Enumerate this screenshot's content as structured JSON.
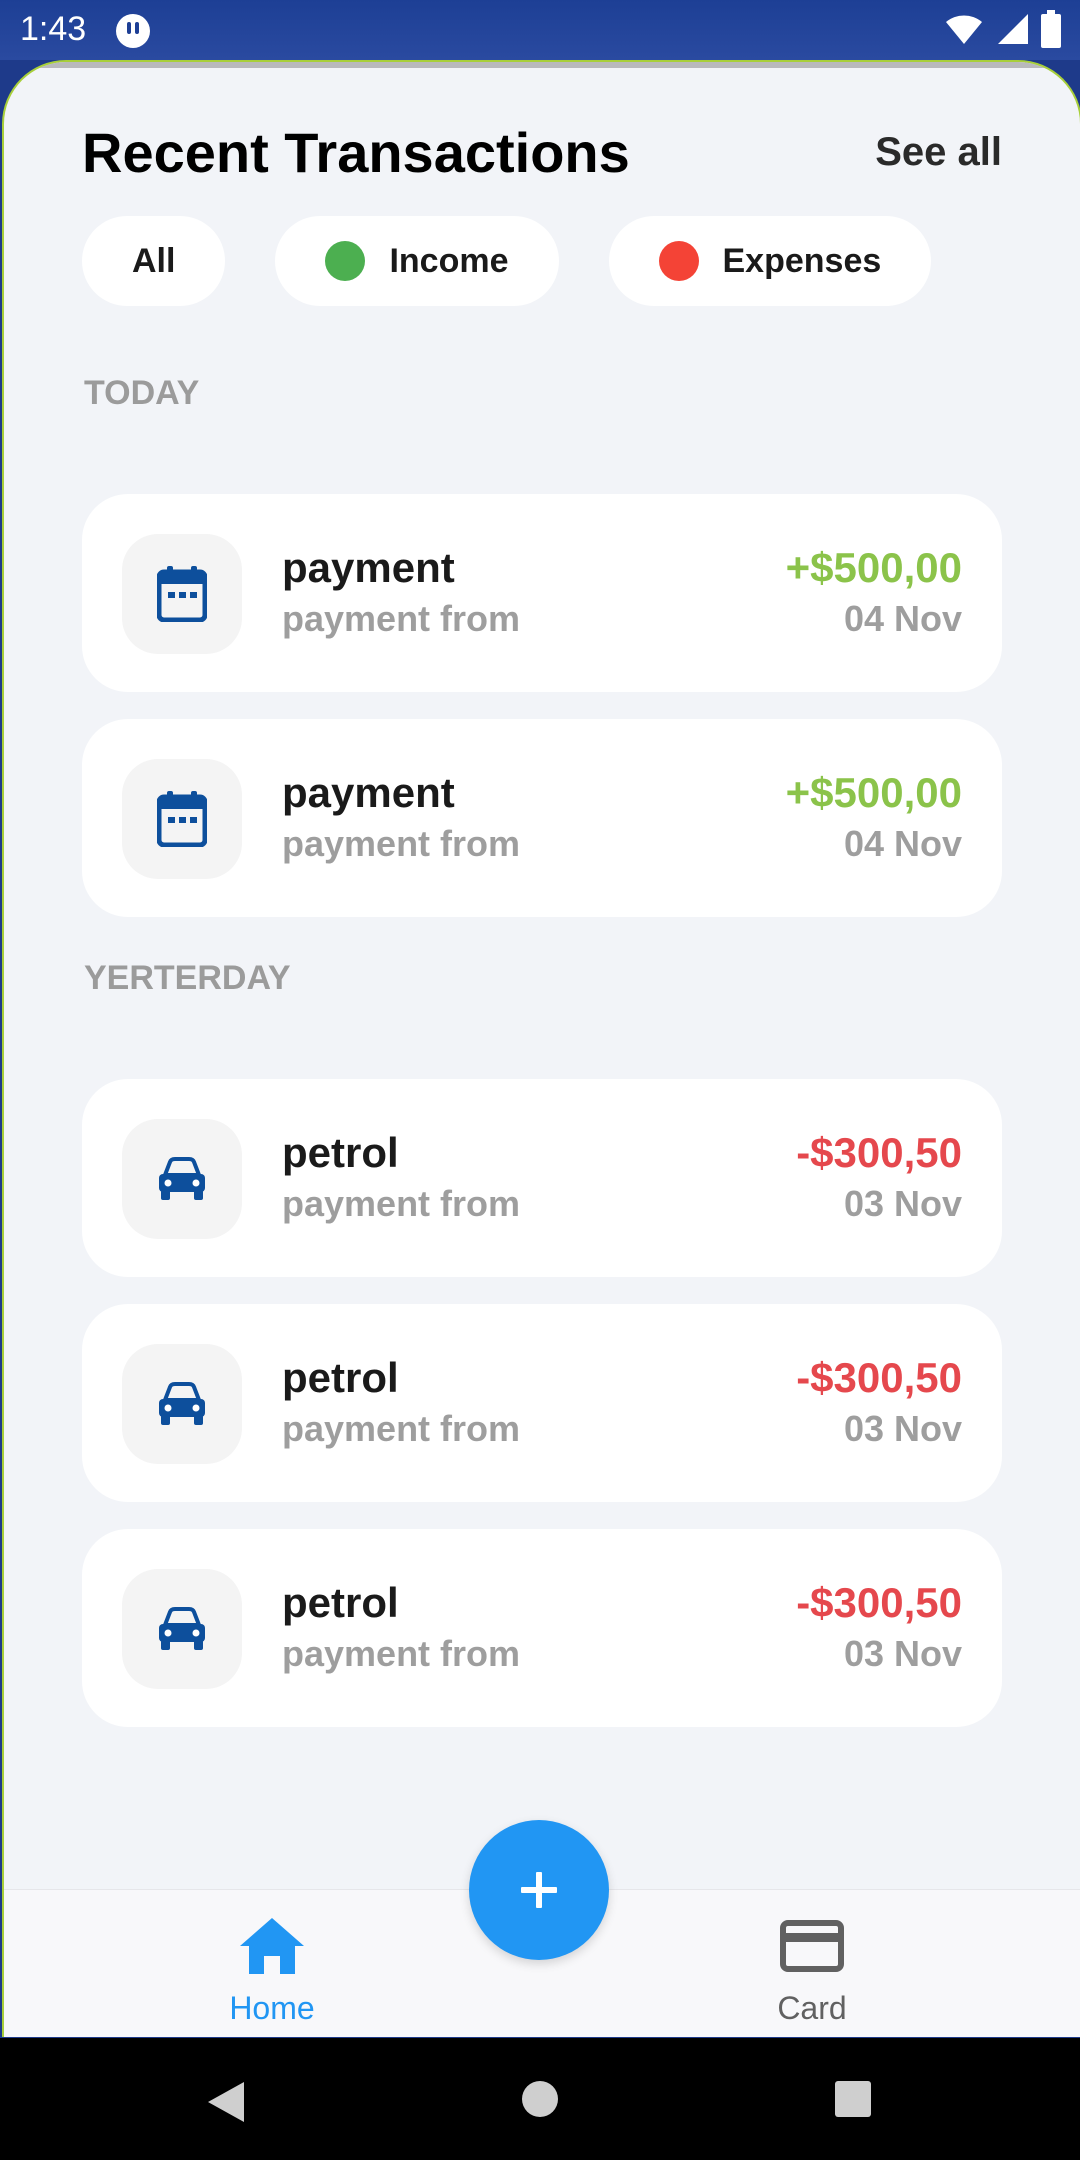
{
  "status_bar": {
    "time": "1:43",
    "icons": [
      "app-notification-icon",
      "wifi-icon",
      "signal-icon",
      "battery-icon"
    ]
  },
  "header": {
    "title": "Recent Transactions",
    "see_all_label": "See all"
  },
  "filters": [
    {
      "label": "All"
    },
    {
      "label": "Income",
      "dot_color": "#4caf50"
    },
    {
      "label": "Expenses",
      "dot_color": "#f44336"
    }
  ],
  "sections": [
    {
      "label": "TODAY",
      "items": [
        {
          "icon": "calendar-icon",
          "title": "payment",
          "subtitle": "payment from",
          "amount": "+$500,00",
          "date": "04 Nov",
          "type": "income"
        },
        {
          "icon": "calendar-icon",
          "title": "payment",
          "subtitle": "payment from",
          "amount": "+$500,00",
          "date": "04 Nov",
          "type": "income"
        }
      ]
    },
    {
      "label": "YERTERDAY",
      "items": [
        {
          "icon": "car-icon",
          "title": "petrol",
          "subtitle": "payment from",
          "amount": "-$300,50",
          "date": "03 Nov",
          "type": "expense"
        },
        {
          "icon": "car-icon",
          "title": "petrol",
          "subtitle": "payment from",
          "amount": "-$300,50",
          "date": "03 Nov",
          "type": "expense"
        },
        {
          "icon": "car-icon",
          "title": "petrol",
          "subtitle": "payment from",
          "amount": "-$300,50",
          "date": "03 Nov",
          "type": "expense"
        }
      ]
    }
  ],
  "bottom_nav": {
    "home_label": "Home",
    "card_label": "Card",
    "fab_icon": "plus-icon"
  },
  "colors": {
    "income": "#8bc34a",
    "expense": "#e5484d",
    "accent": "#2196f3",
    "icon": "#0d4f9c",
    "nav_inactive": "#616161"
  }
}
